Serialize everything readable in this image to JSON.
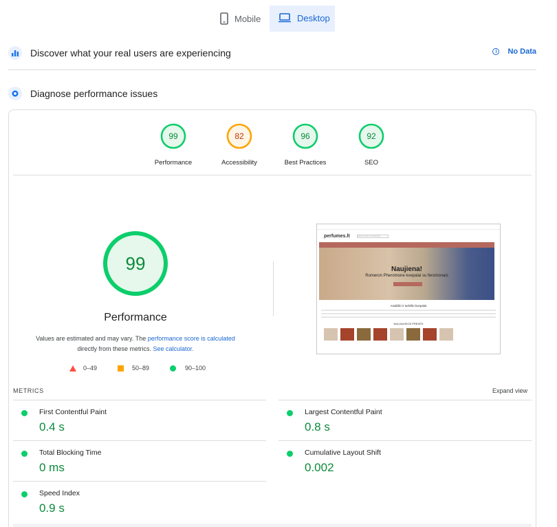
{
  "tabs": [
    {
      "label": "Mobile",
      "icon": "phone-icon",
      "selected": false
    },
    {
      "label": "Desktop",
      "icon": "laptop-icon",
      "selected": true
    }
  ],
  "real_users": {
    "title": "Discover what your real users are experiencing",
    "status": "No Data"
  },
  "diagnose": {
    "title": "Diagnose performance issues"
  },
  "categories": [
    {
      "label": "Performance",
      "score": "99",
      "score_value": 99,
      "color": "#0cce6b"
    },
    {
      "label": "Accessibility",
      "score": "82",
      "score_value": 82,
      "color": "#ffa400"
    },
    {
      "label": "Best Practices",
      "score": "96",
      "score_value": 96,
      "color": "#0cce6b"
    },
    {
      "label": "SEO",
      "score": "92",
      "score_value": 92,
      "color": "#0cce6b"
    }
  ],
  "performance": {
    "score": "99",
    "title": "Performance",
    "desc_pre": "Values are estimated and may vary. The",
    "desc_link1": "performance score is calculated",
    "desc_mid": "directly from these metrics.",
    "desc_link2": "See calculator."
  },
  "legend": {
    "fail": "0–49",
    "average": "50–89",
    "pass": "90–100"
  },
  "screenshot": {
    "site_logo": "perfumes.lt",
    "search_placeholder": "Ieškoti produkto ar kategorijos",
    "hero_title": "Naujiena!",
    "hero_subtitle": "Romeron Pheromone kvepalai su feromonais",
    "section_title": "Arabiški ir turkiški kvepalai",
    "new_title": "NAUJAUSIOS PREKĖS"
  },
  "metrics": {
    "label": "METRICS",
    "expand_label": "Expand view",
    "items": [
      {
        "name": "First Contentful Paint",
        "value": "0.4 s"
      },
      {
        "name": "Largest Contentful Paint",
        "value": "0.8 s"
      },
      {
        "name": "Total Blocking Time",
        "value": "0 ms"
      },
      {
        "name": "Cumulative Layout Shift",
        "value": "0.002"
      },
      {
        "name": "Speed Index",
        "value": "0.9 s"
      }
    ]
  },
  "colors": {
    "pass": "#0cce6b",
    "average": "#ffa400",
    "fail": "#ff4e42",
    "link": "#1967d2"
  }
}
